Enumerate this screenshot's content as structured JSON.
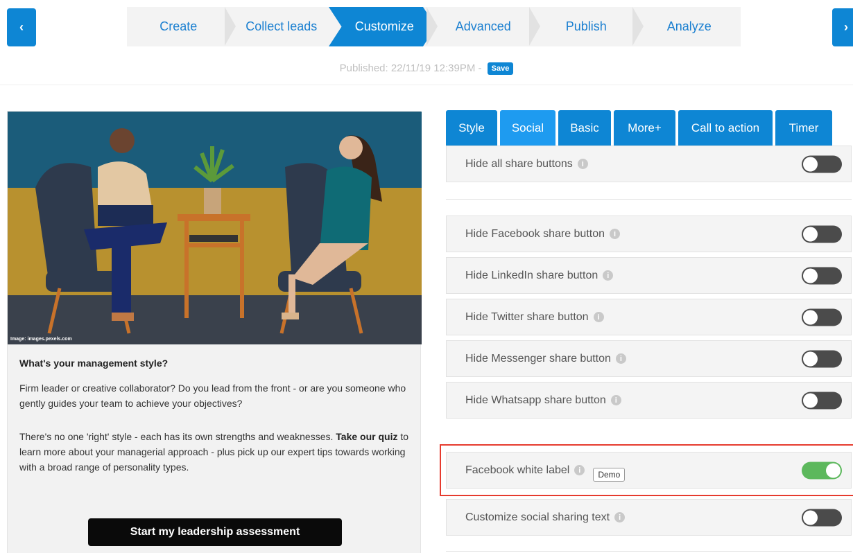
{
  "nav": {
    "prev_label": "‹",
    "next_label": "›"
  },
  "steps": [
    "Create",
    "Collect leads",
    "Customize",
    "Advanced",
    "Publish",
    "Analyze"
  ],
  "published": {
    "text": "Published: 22/11/19 12:39PM  -",
    "save_label": "Save"
  },
  "preview": {
    "photo_credit": "Image: images.pexels.com",
    "title": "What's your management style?",
    "body": "Firm leader or creative collaborator? Do you lead from the front - or are you someone who gently guides your team to achieve your objectives?",
    "body2_before": "There's no one 'right' style - each has its own strengths and weaknesses. ",
    "body2_bold": "Take our quiz",
    "body2_after": " to learn more about your managerial approach - plus pick up our expert tips towards working with a broad range of personality types.",
    "cta_label": "Start my leadership assessment"
  },
  "tabs": [
    "Style",
    "Social",
    "Basic",
    "More+",
    "Call to action",
    "Timer"
  ],
  "settings": {
    "hide_all": "Hide all share buttons",
    "hide_facebook": "Hide Facebook share button",
    "hide_linkedin": "Hide LinkedIn share button",
    "hide_twitter": "Hide Twitter share button",
    "hide_messenger": "Hide Messenger share button",
    "hide_whatsapp": "Hide Whatsapp share button",
    "facebook_white_label": "Facebook white label",
    "demo_badge": "Demo",
    "customize_text": "Customize social sharing text"
  },
  "info_glyph": "i",
  "colors": {
    "accent": "#0e86d4",
    "toggle_on": "#5cb85c",
    "toggle_off": "#4b4b4b",
    "highlight": "#e63b2e"
  }
}
